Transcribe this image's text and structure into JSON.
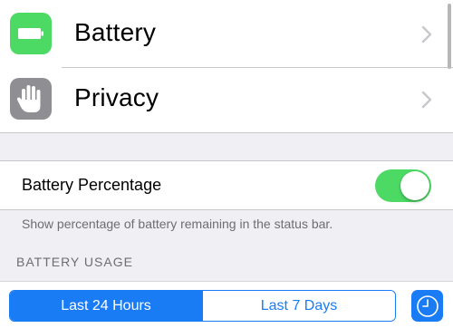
{
  "settings_rows": [
    {
      "label": "Battery",
      "icon": "battery-icon",
      "icon_color": "#4cd964"
    },
    {
      "label": "Privacy",
      "icon": "hand-icon",
      "icon_color": "#8e8e93"
    }
  ],
  "battery_percentage": {
    "label": "Battery Percentage",
    "enabled": true,
    "toggle_color": "#4cd964",
    "footer": "Show percentage of battery remaining in the status bar."
  },
  "usage_section": {
    "header": "BATTERY USAGE"
  },
  "segmented_control": {
    "options": [
      "Last 24 Hours",
      "Last 7 Days"
    ],
    "selected": "Last 24 Hours",
    "accent": "#1a7cf5"
  },
  "clock_button": {
    "icon": "clock-icon"
  }
}
